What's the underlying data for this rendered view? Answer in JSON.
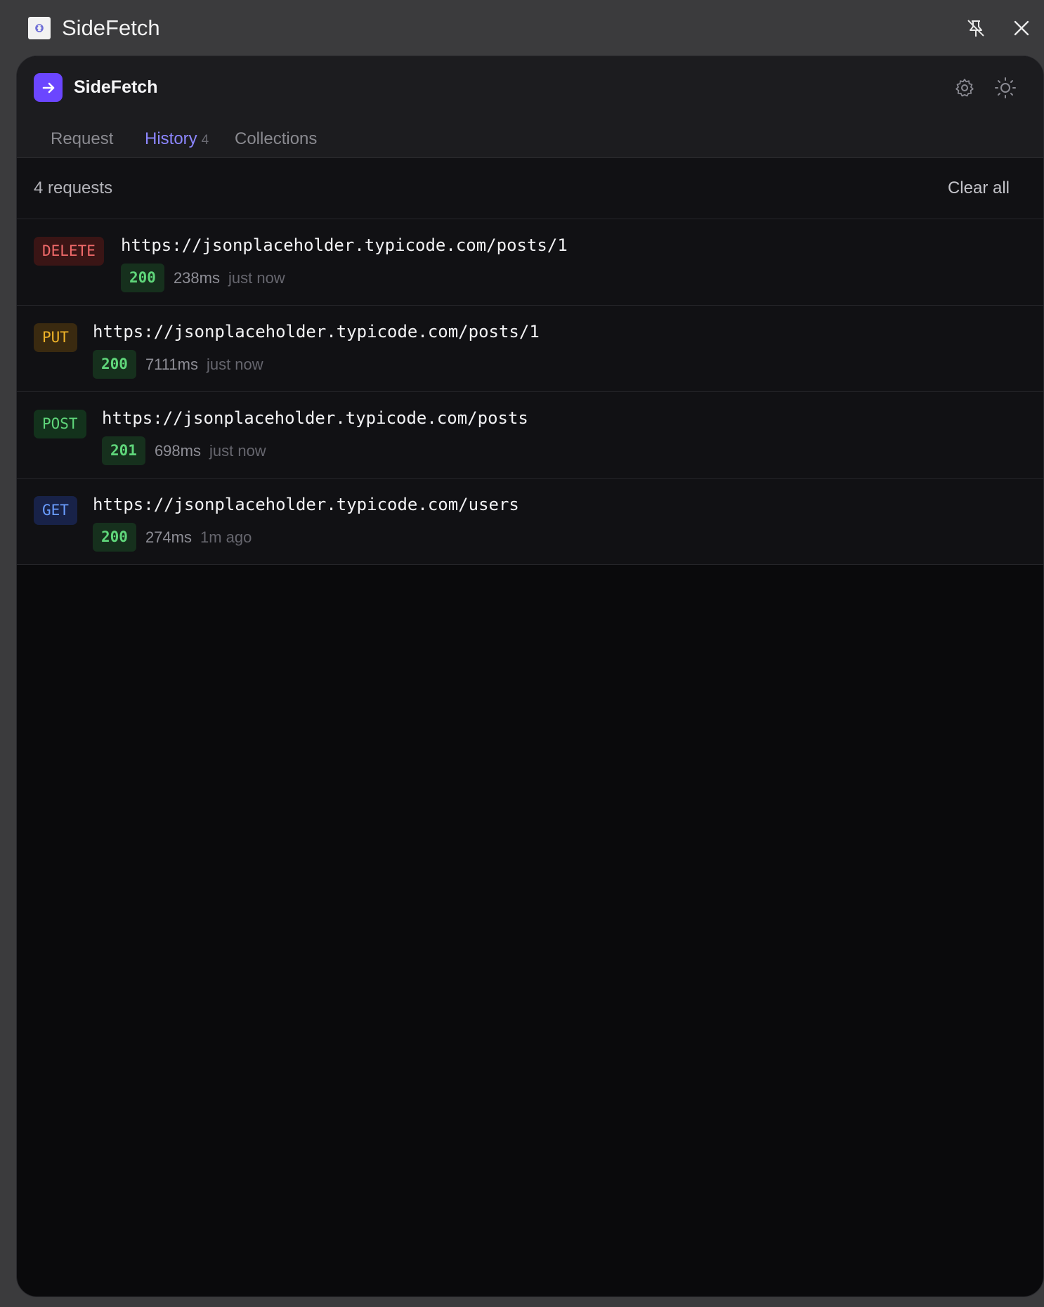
{
  "window": {
    "title": "SideFetch"
  },
  "header": {
    "app_name": "SideFetch"
  },
  "tabs": [
    {
      "label": "Request",
      "count": ""
    },
    {
      "label": "History",
      "count": "4"
    },
    {
      "label": "Collections",
      "count": ""
    }
  ],
  "active_tab": "History",
  "toolbar": {
    "count_text": "4 requests",
    "clear_label": "Clear all"
  },
  "history": [
    {
      "method": "DELETE",
      "url": "https://jsonplaceholder.typicode.com/posts/1",
      "status": "200",
      "duration": "238ms",
      "ago": "just now"
    },
    {
      "method": "PUT",
      "url": "https://jsonplaceholder.typicode.com/posts/1",
      "status": "200",
      "duration": "7111ms",
      "ago": "just now"
    },
    {
      "method": "POST",
      "url": "https://jsonplaceholder.typicode.com/posts",
      "status": "201",
      "duration": "698ms",
      "ago": "just now"
    },
    {
      "method": "GET",
      "url": "https://jsonplaceholder.typicode.com/users",
      "status": "200",
      "duration": "274ms",
      "ago": "1m ago"
    }
  ],
  "colors": {
    "accent": "#7c75ff",
    "brand": "#6b46ff",
    "delete": "#f06a6a",
    "put": "#f0b429",
    "post": "#5fd67a",
    "get": "#6a9dff",
    "status_ok": "#5fd67a"
  },
  "icons": {
    "titlebar_app": "extension-puzzle-icon",
    "unpin": "unpin-icon",
    "close": "close-icon",
    "brand": "arrow-right-icon",
    "settings": "gear-icon",
    "theme": "sun-icon"
  }
}
